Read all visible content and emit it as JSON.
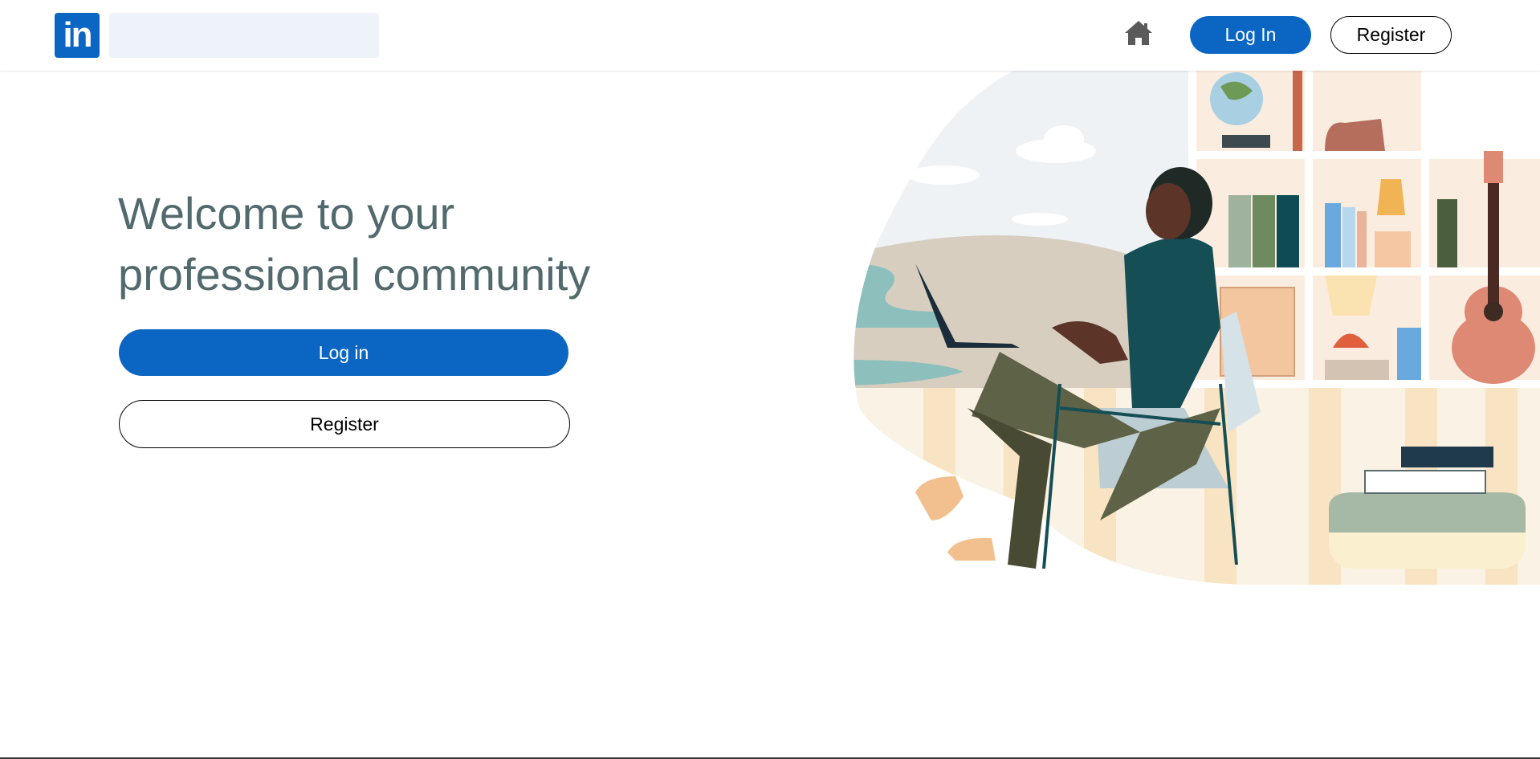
{
  "header": {
    "logo_text": "in",
    "search": {
      "placeholder": "",
      "value": ""
    },
    "home_icon": "home-icon",
    "login_label": "Log In",
    "register_label": "Register"
  },
  "main": {
    "headline_line1": "Welcome to your",
    "headline_line2": "professional community",
    "login_label": "Log in",
    "register_label": "Register"
  },
  "colors": {
    "brand": "#0a66c2",
    "headline": "#526a6e",
    "search_bg": "#edf3f8"
  }
}
